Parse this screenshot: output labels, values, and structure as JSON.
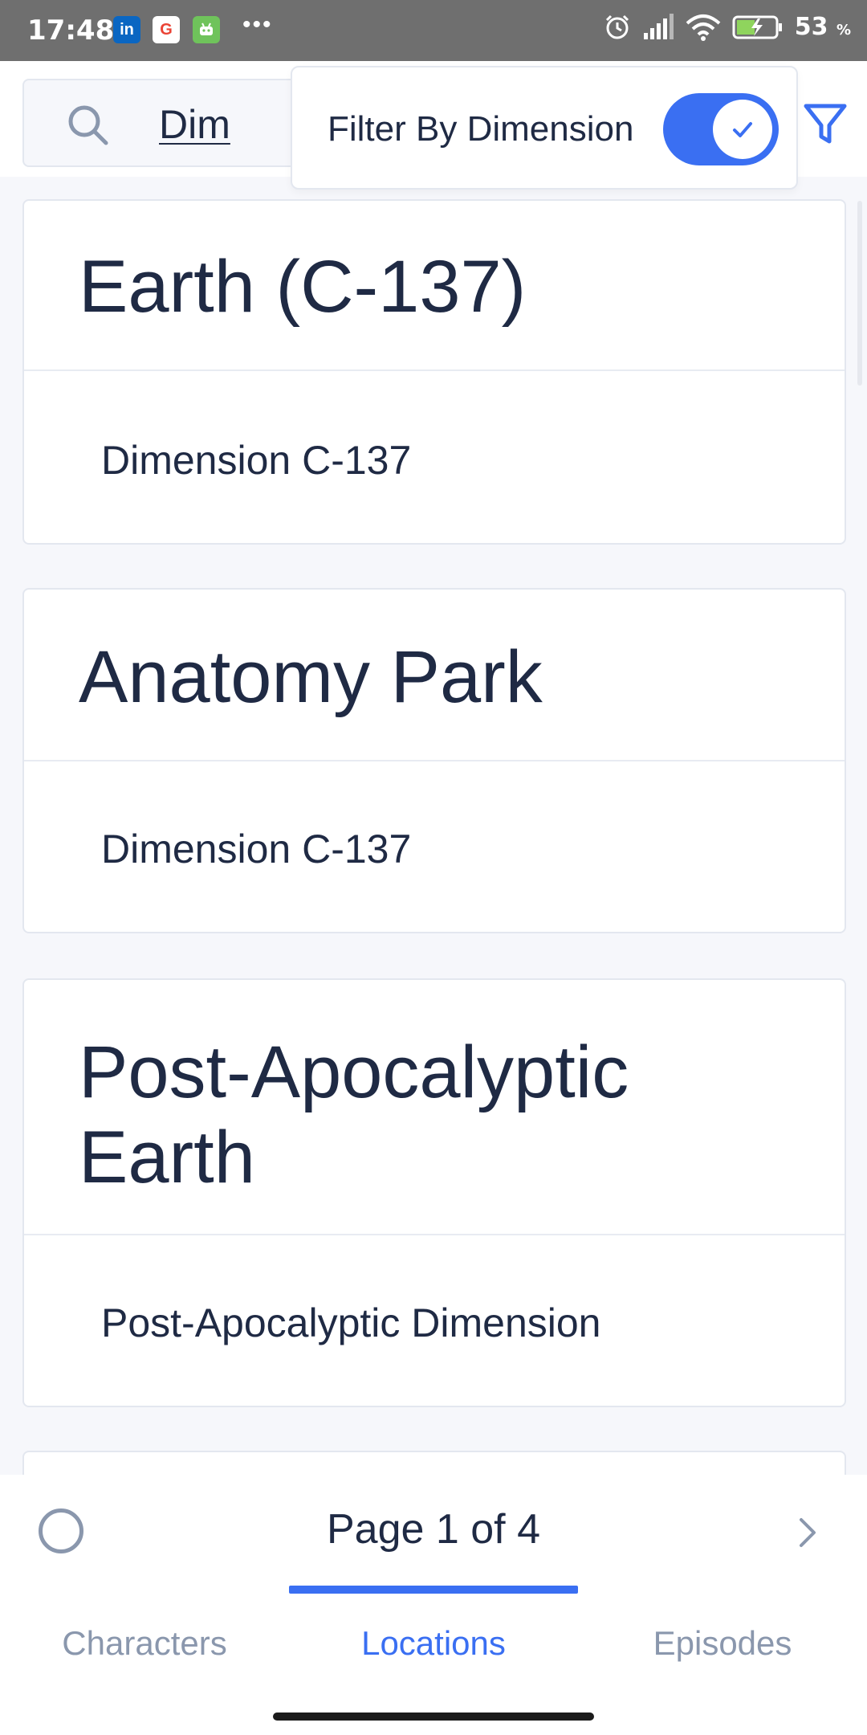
{
  "status_bar": {
    "time": "17:48",
    "apps": [
      "in",
      "G",
      "android-icon"
    ],
    "battery_percent": "53",
    "battery_unit": "%"
  },
  "search": {
    "value": "Dim"
  },
  "filter": {
    "label": "Filter By Dimension",
    "enabled": true
  },
  "locations": [
    {
      "name": "Earth (C-137)",
      "dimension": "Dimension C-137"
    },
    {
      "name": "Anatomy Park",
      "dimension": "Dimension C-137"
    },
    {
      "name": "Post-Apocalyptic Earth",
      "dimension": "Post-Apocalyptic Dimension"
    }
  ],
  "pagination": {
    "label": "Page 1 of 4"
  },
  "tabs": [
    {
      "label": "Characters",
      "active": false
    },
    {
      "label": "Locations",
      "active": true
    },
    {
      "label": "Episodes",
      "active": false
    }
  ],
  "colors": {
    "accent": "#3a6ff2",
    "text": "#1f2a44",
    "muted": "#8a97ad"
  }
}
